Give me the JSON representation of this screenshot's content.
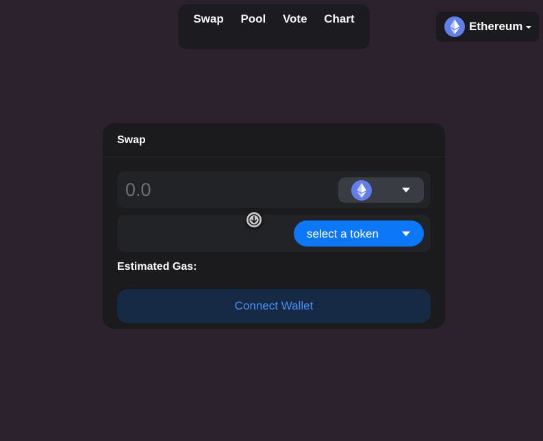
{
  "nav": {
    "items": [
      {
        "label": "Swap"
      },
      {
        "label": "Pool"
      },
      {
        "label": "Vote"
      },
      {
        "label": "Chart"
      }
    ]
  },
  "network": {
    "label": "Ethereum",
    "icon": "ethereum-icon"
  },
  "swap_card": {
    "title": "Swap",
    "input": {
      "placeholder": "0.0",
      "value": "",
      "token_icon": "ethereum-icon"
    },
    "output": {
      "select_label": "select a token"
    },
    "switch_icon": "arrow-down-icon",
    "gas_label": "Estimated Gas:",
    "connect_label": "Connect Wallet"
  },
  "colors": {
    "background": "#2b222e",
    "card": "#1b1b1e",
    "accent": "#0c77f7",
    "connect_text": "#4c8ef7",
    "connect_bg": "#172a45",
    "ethereum": "#627eea"
  }
}
